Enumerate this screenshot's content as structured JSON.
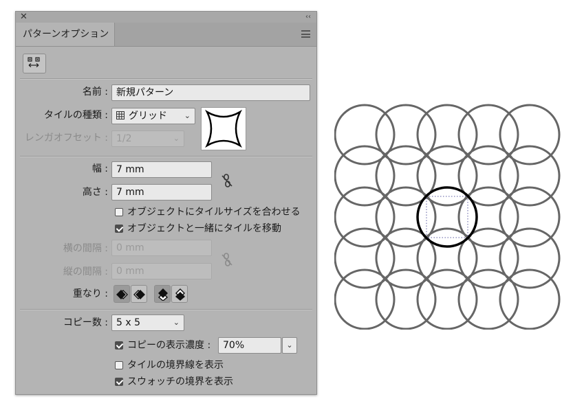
{
  "panel": {
    "title_close": "✕",
    "collapse": "‹‹",
    "tab_label": "パターンオプション"
  },
  "form": {
    "name_label": "名前 :",
    "name_value": "新規パターン",
    "tile_type_label": "タイルの種類 :",
    "tile_type_value": "グリッド",
    "brick_offset_label": "レンガオフセット :",
    "brick_offset_value": "1/2",
    "width_label": "幅 :",
    "width_value": "7 mm",
    "height_label": "高さ :",
    "height_value": "7 mm",
    "fit_tile_label": "オブジェクトにタイルサイズを合わせる",
    "fit_tile_checked": false,
    "move_tile_label": "オブジェクトと一緒にタイルを移動",
    "move_tile_checked": true,
    "h_spacing_label": "横の間隔 :",
    "h_spacing_value": "0 mm",
    "v_spacing_label": "縦の間隔 :",
    "v_spacing_value": "0 mm",
    "overlap_label": "重なり :",
    "copies_label": "コピー数 :",
    "copies_value": "5 x 5",
    "dim_copies_label": "コピーの表示濃度 :",
    "dim_copies_checked": true,
    "dim_copies_value": "70%",
    "show_tile_edge_label": "タイルの境界線を表示",
    "show_tile_edge_checked": false,
    "show_swatch_bounds_label": "スウォッチの境界を表示",
    "show_swatch_bounds_checked": true
  },
  "artwork": {
    "copies_grid": [
      5,
      5
    ],
    "copy_stroke_color": "#666666",
    "original_stroke_color": "#000000"
  }
}
